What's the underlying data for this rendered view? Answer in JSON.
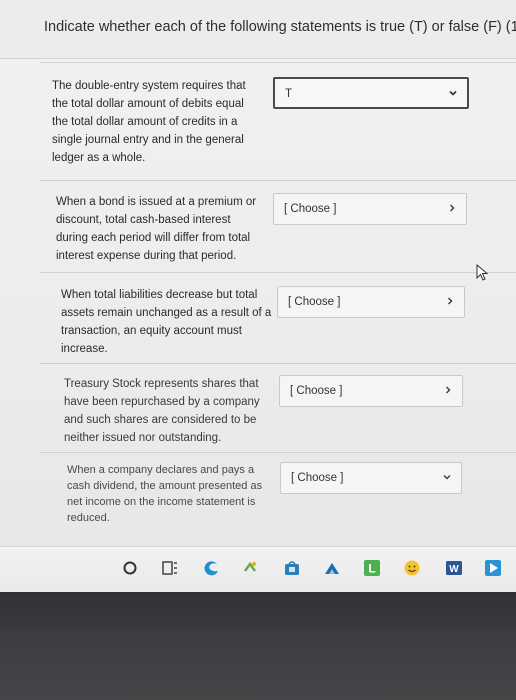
{
  "header": {
    "title": "Indicate whether each of the following statements is true (T) or false (F) (1"
  },
  "questions": [
    {
      "lines": [
        "The double-entry system requires that",
        "the total dollar amount of debits equal",
        "the total dollar amount of credits in a",
        "single journal entry and in the general",
        "ledger as a whole."
      ],
      "answer": "T"
    },
    {
      "lines": [
        "When a bond is issued at a premium or",
        "discount, total cash-based interest",
        "during each period will differ from total",
        "interest expense during that period."
      ],
      "answer": "[ Choose ]"
    },
    {
      "lines": [
        "When total liabilities decrease but total",
        "assets remain unchanged as a result of a",
        "transaction, an equity account must",
        "increase."
      ],
      "answer": "[ Choose ]"
    },
    {
      "lines": [
        "Treasury Stock represents shares that",
        "have been repurchased by a company",
        "and such shares are considered to be",
        "neither issued nor outstanding."
      ],
      "answer": "[ Choose ]"
    },
    {
      "lines": [
        "When a company declares and pays a",
        "cash dividend, the amount presented as",
        "net income on the income statement is",
        "reduced."
      ],
      "answer": "[ Choose ]"
    }
  ],
  "taskbar": {
    "icons": [
      "search-circle-icon",
      "task-view-icon",
      "edge-icon",
      "app-icon",
      "store-icon",
      "network-icon",
      "launcher-icon",
      "emoji-icon",
      "word-icon",
      "media-icon"
    ],
    "word_letter": "W",
    "launcher_letter": "L"
  },
  "colors": {
    "page_bg": "#ececec",
    "text": "#2a2a2a",
    "border": "#c9c9c9",
    "edge_blue": "#1f8fd1",
    "word_blue": "#2b5797",
    "launcher_green": "#4caf50"
  }
}
